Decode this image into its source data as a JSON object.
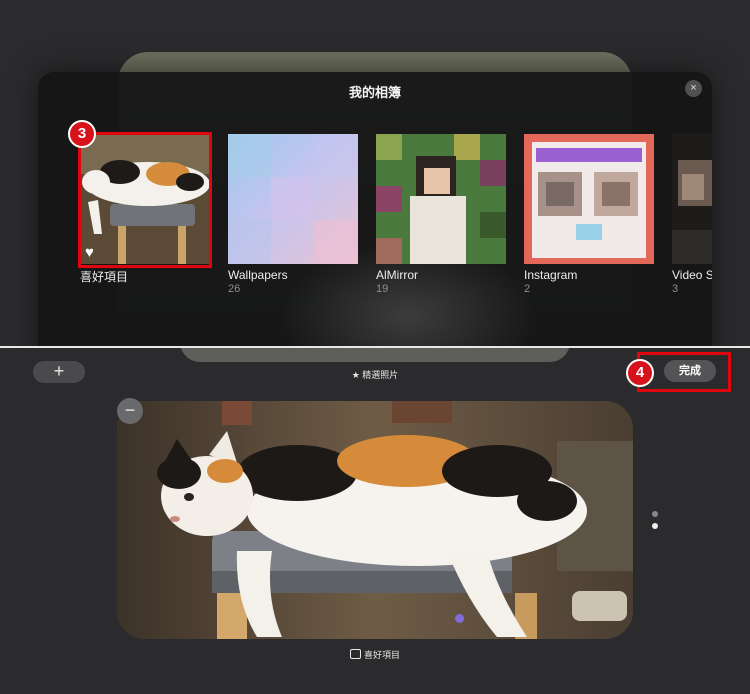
{
  "sheet": {
    "title": "我的相簿",
    "close_icon": "×"
  },
  "albums": [
    {
      "name": "喜好項目",
      "count": ""
    },
    {
      "name": "Wallpapers",
      "count": "26"
    },
    {
      "name": "AlMirror",
      "count": "19"
    },
    {
      "name": "Instagram",
      "count": "2"
    },
    {
      "name": "Video S",
      "count": "3"
    }
  ],
  "badges": {
    "step3": "3",
    "step4": "4"
  },
  "toolbar": {
    "add_label": "+",
    "featured_label": "★ 精選照片",
    "done_label": "完成"
  },
  "photo": {
    "remove_label": "−",
    "source_label": "喜好項目"
  },
  "colors": {
    "highlight": "#e1060d",
    "badge": "#d8121a",
    "background": "#2b2b2d"
  }
}
